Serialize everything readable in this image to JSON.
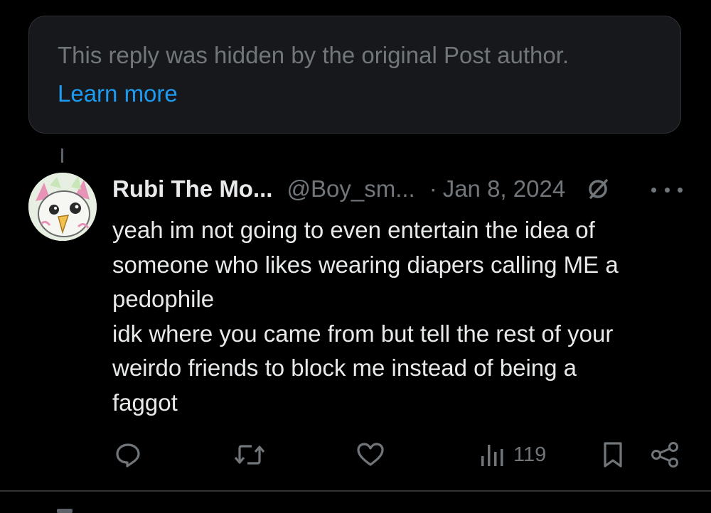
{
  "hidden_notice": {
    "text": "This reply was hidden by the original Post author.",
    "link_label": "Learn more"
  },
  "reply": {
    "author_name": "Rubi The Mo...",
    "handle": "@Boy_sm...",
    "separator": "·",
    "date": "Jan 8, 2024",
    "body_lines": [
      "yeah im not going to even entertain the idea of",
      "someone who likes wearing diapers calling ME a",
      "pedophile",
      "idk where you came from but tell the rest of your",
      "weirdo friends to block me instead of being a",
      "faggot"
    ],
    "actions": {
      "views_count": "119"
    }
  },
  "colors": {
    "background": "#000000",
    "card": "#16181c",
    "text_primary": "#e7e9ea",
    "text_secondary": "#71767b",
    "link": "#1d9bf0"
  },
  "icons": [
    "verified-icon",
    "more-icon",
    "reply-icon",
    "repost-icon",
    "like-icon",
    "views-icon",
    "bookmark-icon",
    "share-icon"
  ]
}
